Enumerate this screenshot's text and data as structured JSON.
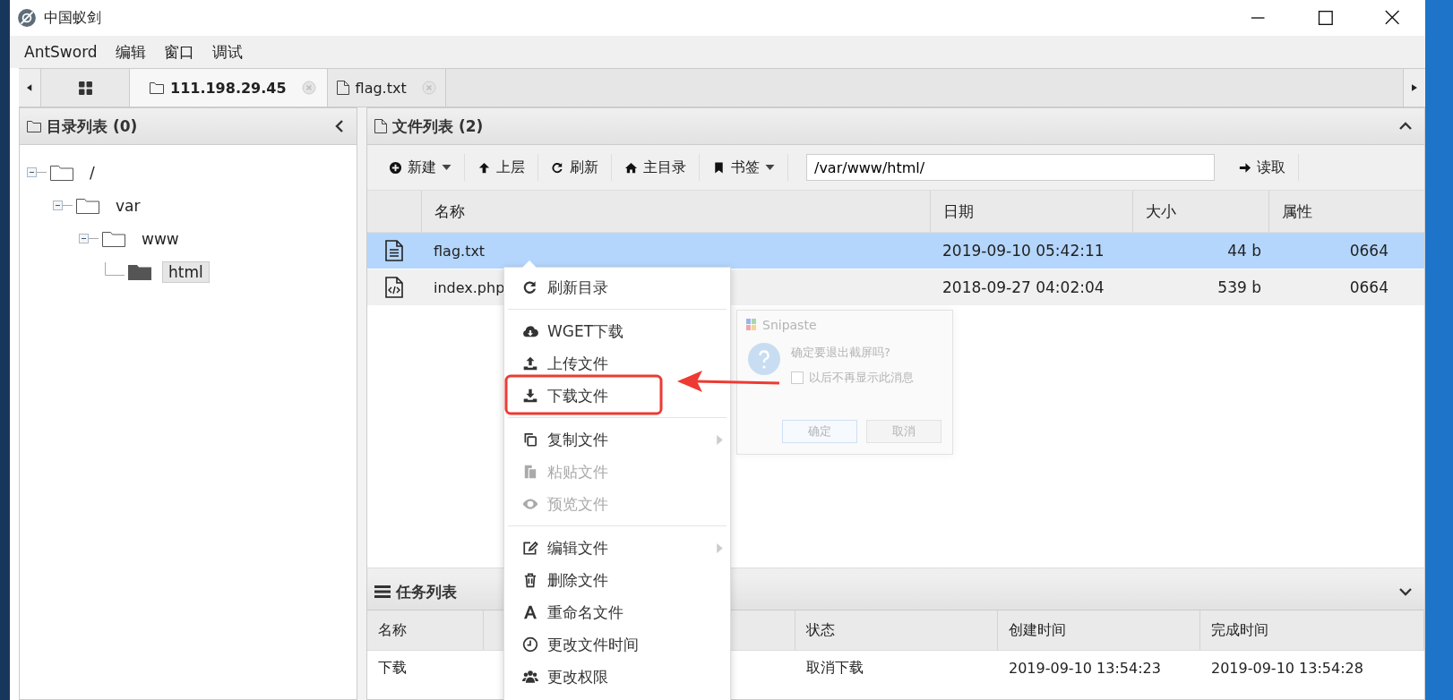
{
  "window": {
    "title": "中国蚁剑"
  },
  "menubar": [
    "AntSword",
    "编辑",
    "窗口",
    "调试"
  ],
  "tabs": [
    {
      "kind": "grid",
      "selected": false
    },
    {
      "kind": "folder",
      "label": "111.198.29.45",
      "selected": true
    },
    {
      "kind": "file",
      "label": "flag.txt",
      "selected": false
    }
  ],
  "directory_panel": {
    "title": "目录列表 (0)",
    "tree": [
      {
        "label": "/",
        "expanded": true,
        "selected": false,
        "children": [
          {
            "label": "var",
            "expanded": true,
            "selected": false,
            "children": [
              {
                "label": "www",
                "expanded": true,
                "selected": false,
                "children": [
                  {
                    "label": "html",
                    "selected": true
                  }
                ]
              }
            ]
          }
        ]
      }
    ]
  },
  "file_panel": {
    "title": "文件列表 (2)",
    "toolbar": [
      {
        "label": "新建",
        "dropdown": true
      },
      {
        "label": "上层",
        "dropdown": false
      },
      {
        "label": "刷新",
        "dropdown": false
      },
      {
        "label": "主目录",
        "dropdown": false
      },
      {
        "label": "书签",
        "dropdown": true
      }
    ],
    "path": "/var/www/html/",
    "read_button": "读取",
    "columns": [
      "名称",
      "日期",
      "大小",
      "属性"
    ],
    "rows": [
      {
        "kind": "text",
        "name": "flag.txt",
        "date": "2019-09-10 05:42:11",
        "size": "44 b",
        "mode": "0664",
        "selected": true
      },
      {
        "kind": "code",
        "name": "index.php",
        "date": "2018-09-27 04:02:04",
        "size": "539 b",
        "mode": "0664",
        "selected": false
      }
    ]
  },
  "task_panel": {
    "title": "任务列表",
    "columns": [
      "名称",
      "状态",
      "创建时间",
      "完成时间"
    ],
    "rows": [
      {
        "name": "下载",
        "status": "取消下载",
        "created": "2019-09-10 13:54:23",
        "finished": "2019-09-10 13:54:28"
      }
    ]
  },
  "context_menu": {
    "items": [
      {
        "kind": "item",
        "label": "刷新目录",
        "disabled": false,
        "submenu": false
      },
      {
        "kind": "separator"
      },
      {
        "kind": "item",
        "label": "WGET下载",
        "disabled": false,
        "submenu": false
      },
      {
        "kind": "item",
        "label": "上传文件",
        "disabled": false,
        "submenu": false
      },
      {
        "kind": "item",
        "label": "下载文件",
        "disabled": false,
        "submenu": false
      },
      {
        "kind": "separator"
      },
      {
        "kind": "item",
        "label": "复制文件",
        "disabled": false,
        "submenu": true
      },
      {
        "kind": "item",
        "label": "粘贴文件",
        "disabled": true,
        "submenu": false
      },
      {
        "kind": "item",
        "label": "预览文件",
        "disabled": true,
        "submenu": false
      },
      {
        "kind": "separator"
      },
      {
        "kind": "item",
        "label": "编辑文件",
        "disabled": false,
        "submenu": true
      },
      {
        "kind": "item",
        "label": "删除文件",
        "disabled": false,
        "submenu": false
      },
      {
        "kind": "item",
        "label": "重命名文件",
        "disabled": false,
        "submenu": false
      },
      {
        "kind": "item",
        "label": "更改文件时间",
        "disabled": false,
        "submenu": false
      },
      {
        "kind": "item",
        "label": "更改权限",
        "disabled": false,
        "submenu": false
      }
    ]
  },
  "dialog": {
    "title": "Snipaste",
    "message": "确定要退出截屏吗?",
    "checkbox": {
      "label": "以后不再显示此消息",
      "checked": false
    },
    "buttons": [
      "确定",
      "取消"
    ]
  }
}
